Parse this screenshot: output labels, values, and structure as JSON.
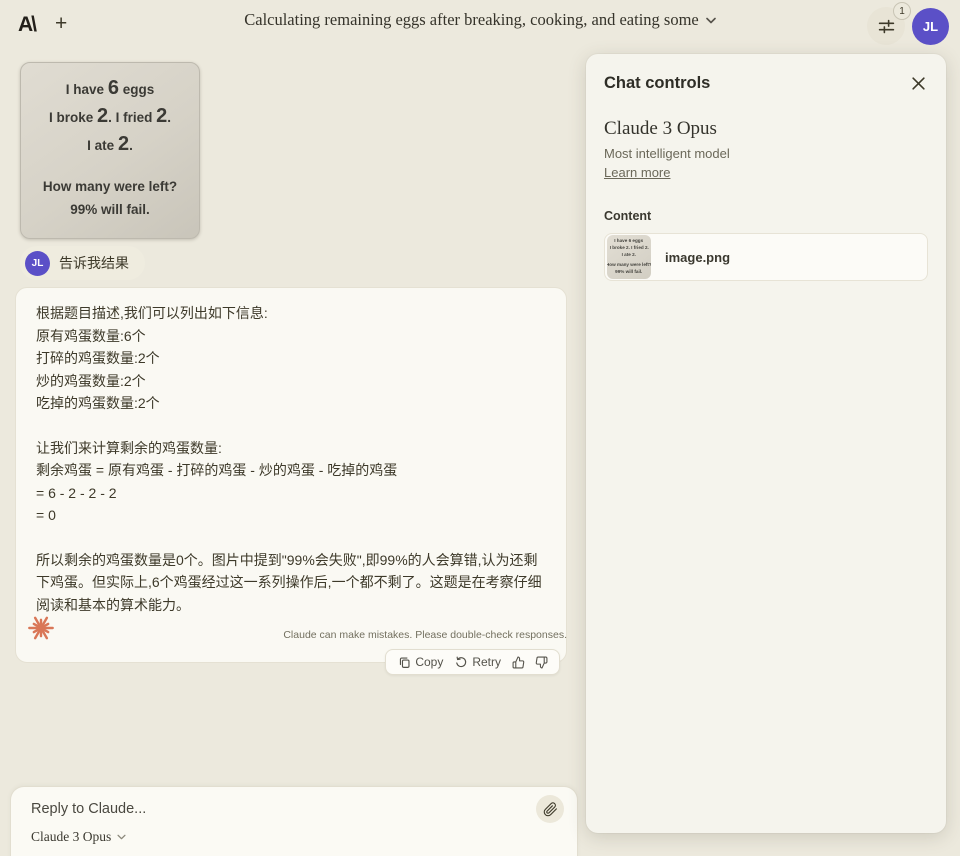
{
  "header": {
    "logo_text": "A\\",
    "new_chat_label": "+",
    "title": "Calculating remaining eggs after breaking, cooking, and eating some",
    "notification_count": "1",
    "avatar_initials": "JL"
  },
  "attachment": {
    "lines": [
      {
        "s0": "I have ",
        "s1": "6",
        "s2": " eggs"
      },
      {
        "s0": "I broke ",
        "s1": "2",
        "s2": ". I fried ",
        "s3": "2",
        "s4": "."
      },
      {
        "s0": "I ate ",
        "s1": "2",
        "s2": "."
      },
      {
        "s0": "How many were left?"
      },
      {
        "s0": "99% will fail."
      }
    ],
    "plain_lines": [
      "I have 6 eggs",
      "I broke 2. I fried 2.",
      "I ate 2.",
      "How many were left?",
      "99% will fail."
    ]
  },
  "user_message": {
    "avatar_initials": "JL",
    "text": "告诉我结果"
  },
  "assistant_message": {
    "p1": [
      "根据题目描述,我们可以列出如下信息:",
      "原有鸡蛋数量:6个",
      "打碎的鸡蛋数量:2个",
      "炒的鸡蛋数量:2个",
      "吃掉的鸡蛋数量:2个"
    ],
    "p2": [
      "让我们来计算剩余的鸡蛋数量:",
      "剩余鸡蛋 = 原有鸡蛋 - 打碎的鸡蛋 - 炒的鸡蛋 - 吃掉的鸡蛋",
      "= 6 - 2 - 2 - 2",
      "= 0"
    ],
    "p3": "所以剩余的鸡蛋数量是0个。图片中提到\"99%会失败\",即99%的人会算错,认为还剩下鸡蛋。但实际上,6个鸡蛋经过这一系列操作后,一个都不剩了。这题是在考察仔细阅读和基本的算术能力。"
  },
  "actions": {
    "copy": "Copy",
    "retry": "Retry"
  },
  "footer_note": "Claude can make mistakes. Please double-check responses.",
  "composer": {
    "placeholder": "Reply to Claude...",
    "model": "Claude 3 Opus"
  },
  "panel": {
    "title": "Chat controls",
    "model_name": "Claude 3 Opus",
    "model_description": "Most intelligent model",
    "learn_more": "Learn more",
    "content_heading": "Content",
    "file_name": "image.png"
  },
  "colors": {
    "avatar_purple": "#5B50C7",
    "claude_orange": "#D97757",
    "background": "#ECE9DD",
    "panel_background": "#F5F4ED"
  }
}
